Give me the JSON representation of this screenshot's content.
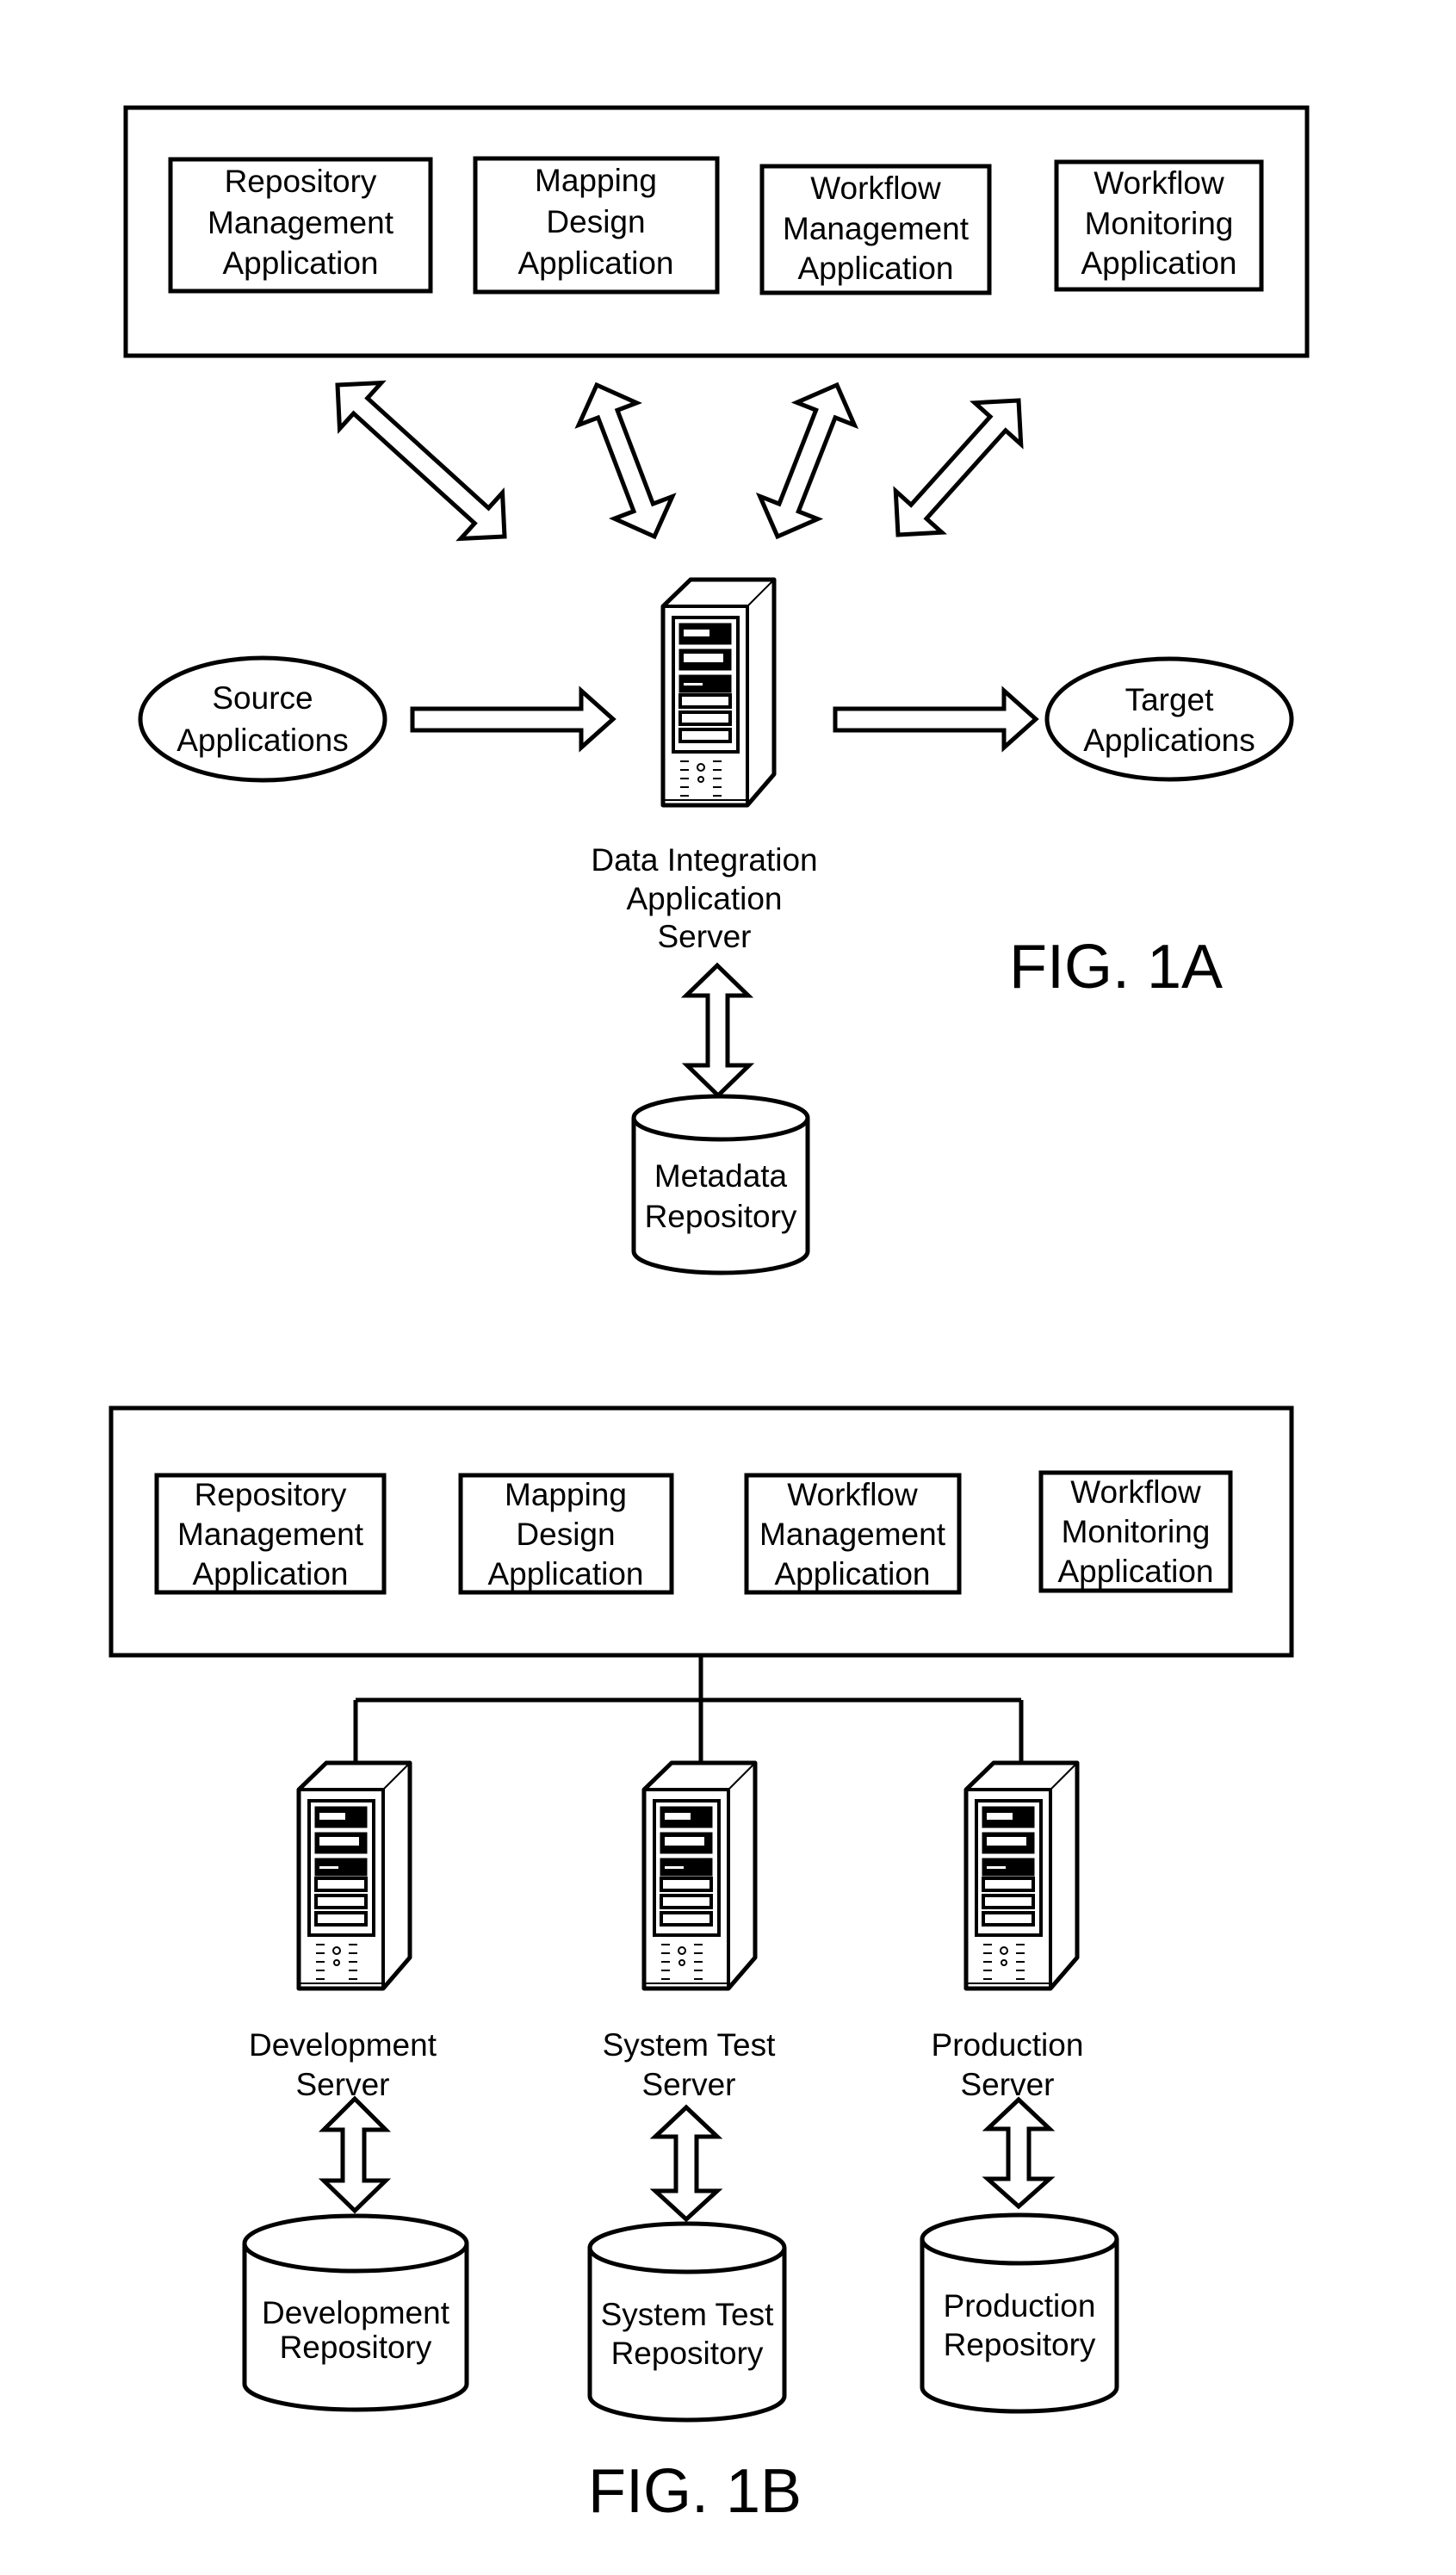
{
  "fig1a": {
    "caption": "FIG. 1A",
    "client_applications": [
      {
        "lines": [
          "Repository",
          "Management",
          "Application"
        ]
      },
      {
        "lines": [
          "Mapping",
          "Design",
          "Application"
        ]
      },
      {
        "lines": [
          "Workflow",
          "Management",
          "Application"
        ]
      },
      {
        "lines": [
          "Workflow",
          "Monitoring",
          "Application"
        ]
      }
    ],
    "source": {
      "lines": [
        "Source",
        "Applications"
      ]
    },
    "target": {
      "lines": [
        "Target",
        "Applications"
      ]
    },
    "server": {
      "lines": [
        "Data Integration",
        "Application",
        "Server"
      ],
      "icon": "server-tower-icon"
    },
    "repository": {
      "lines": [
        "Metadata",
        "Repository"
      ],
      "icon": "database-cylinder-icon"
    },
    "connections": [
      {
        "from": "Repository Management Application",
        "to": "Data Integration Application Server",
        "type": "bidirectional"
      },
      {
        "from": "Mapping Design Application",
        "to": "Data Integration Application Server",
        "type": "bidirectional"
      },
      {
        "from": "Workflow Management Application",
        "to": "Data Integration Application Server",
        "type": "bidirectional"
      },
      {
        "from": "Workflow Monitoring Application",
        "to": "Data Integration Application Server",
        "type": "bidirectional"
      },
      {
        "from": "Source Applications",
        "to": "Data Integration Application Server",
        "type": "directed"
      },
      {
        "from": "Data Integration Application Server",
        "to": "Target Applications",
        "type": "directed"
      },
      {
        "from": "Data Integration Application Server",
        "to": "Metadata Repository",
        "type": "bidirectional"
      }
    ]
  },
  "fig1b": {
    "caption": "FIG. 1B",
    "client_applications": [
      {
        "lines": [
          "Repository",
          "Management",
          "Application"
        ]
      },
      {
        "lines": [
          "Mapping",
          "Design",
          "Application"
        ]
      },
      {
        "lines": [
          "Workflow",
          "Management",
          "Application"
        ]
      },
      {
        "lines": [
          "Workflow",
          "Monitoring",
          "Application"
        ]
      }
    ],
    "servers": [
      {
        "lines": [
          "Development",
          "Server"
        ],
        "repository": [
          "Development",
          "Repository"
        ]
      },
      {
        "lines": [
          "System Test",
          "Server"
        ],
        "repository": [
          "System Test",
          "Repository"
        ]
      },
      {
        "lines": [
          "Production",
          "Server"
        ],
        "repository": [
          "Production",
          "Repository"
        ]
      }
    ]
  }
}
